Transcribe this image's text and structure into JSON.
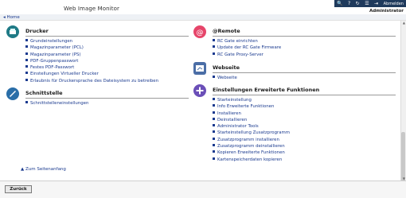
{
  "header": {
    "app_title": "Web Image Monitor",
    "logout_label": "Abmelden",
    "user": "Administrator"
  },
  "breadcrumb": {
    "home": "Home"
  },
  "sections": {
    "drucker": {
      "title": "Drucker",
      "icon": "printer-icon",
      "items": [
        "Grundeinstellungen",
        "Magazinparameter (PCL)",
        "Magazinparameter (PS)",
        "PDF-Gruppenpasswort",
        "Festes PDF-Passwort",
        "Einstellungen Virtueller Drucker",
        "Erlaubnis für Druckersprache des Dateisystem zu betreiben"
      ]
    },
    "schnittstelle": {
      "title": "Schnittstelle",
      "icon": "network-icon",
      "items": [
        "Schnittstelleneinstellungen"
      ]
    },
    "remote": {
      "title": "@Remote",
      "icon": "remote-icon",
      "items": [
        "RC Gate einrichten",
        "Update der RC Gate Firmware",
        "RC Gate Proxy-Server"
      ]
    },
    "webseite": {
      "title": "Webseite",
      "icon": "webpage-icon",
      "items": [
        "Webseite"
      ]
    },
    "erweitert": {
      "title": "Einstellungen Erweiterte Funktionen",
      "icon": "plus-icon",
      "items": [
        "Starteinstellung",
        "Info Erweiterte Funktionen",
        "Installieren",
        "Deinstallieren",
        "Administrator Tools",
        "Starteinstellung Zusatzprogramm",
        "Zusatzprogramm installieren",
        "Zusatzprogramm deinstallieren",
        "Kopieren Erweiterte Funktionen",
        "Kartenspeicherdaten kopieren"
      ]
    }
  },
  "top_link": "Zum Seitenanfang",
  "footer": {
    "back_label": "Zurück"
  }
}
